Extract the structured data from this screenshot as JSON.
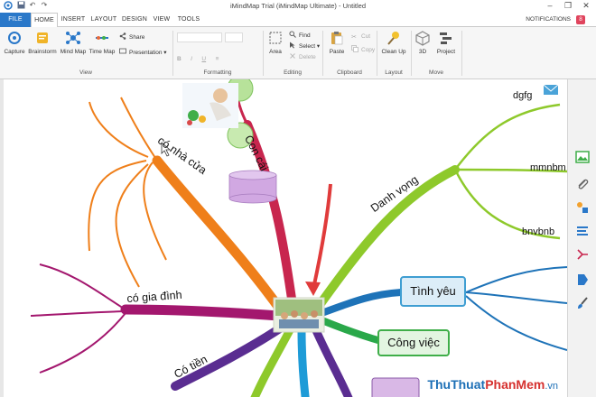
{
  "window": {
    "title": "iMindMap Trial (iMindMap Ultimate) - Untitled",
    "minimize_glyph": "–",
    "maximize_glyph": "❐",
    "close_glyph": "✕"
  },
  "quick_access": [
    "save-icon",
    "undo-icon",
    "redo-icon"
  ],
  "tabs": {
    "file": "FILE",
    "home": "HOME",
    "insert": "INSERT",
    "layout": "LAYOUT",
    "design": "DESIGN",
    "view": "VIEW",
    "tools": "TOOLS"
  },
  "notifications": {
    "label": "NOTIFICATIONS",
    "count": "8"
  },
  "ribbon": {
    "view_group": {
      "label": "View",
      "capture": "Capture",
      "brainstorm": "Brainstorm",
      "mind_map": "Mind Map",
      "time_map": "Time Map",
      "share": "Share",
      "presentation": "Presentation ▾"
    },
    "formatting_group": {
      "label": "Formatting"
    },
    "editing_group": {
      "label": "Editing",
      "area": "Area",
      "find": "Find",
      "select": "Select ▾",
      "delete": "Delete"
    },
    "clipboard_group": {
      "label": "Clipboard",
      "paste": "Paste",
      "cut": "Cut",
      "copy": "Copy"
    },
    "layout_group": {
      "label": "Layout",
      "clean_up": "Clean Up"
    },
    "move_group": {
      "label": "Move",
      "three_d": "3D",
      "project": "Project"
    }
  },
  "mindmap": {
    "branches": {
      "con_cai": "Con cái",
      "co_nha_cua": "có nhà cửa",
      "co_gia_dinh": "có gia đình",
      "co_tien": "Có tiền",
      "danh_vong": "Danh vọng",
      "tinh_yeu": "Tình yêu",
      "cong_viec": "Công việc"
    },
    "leaves": {
      "dgfg": "dgfg",
      "mmnbm": "mmnbm",
      "bnvbnb": "bnvbnb"
    },
    "colors": {
      "con_cai": "#c8264e",
      "co_nha_cua": "#ef7f1a",
      "co_gia_dinh": "#a3176e",
      "danh_vong": "#8ec92b",
      "tinh_yeu": "#1e73b8",
      "cong_viec": "#2aa84a",
      "co_tien": "#5a2d91",
      "arrow": "#e03b3b"
    }
  },
  "sidebar_icons": [
    "image-icon",
    "attachment-icon",
    "shapes-icon",
    "list-icon",
    "branch-tool-icon",
    "tag-icon",
    "brush-icon"
  ],
  "watermark": {
    "part1": "ThuThuat",
    "part2": "PhanMem",
    "part3": ".vn"
  }
}
